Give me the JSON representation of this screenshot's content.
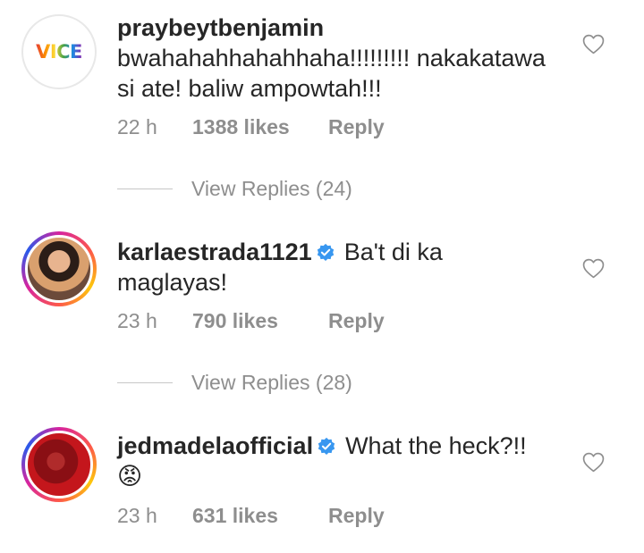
{
  "comments": [
    {
      "username": "praybeytbenjamin",
      "verified": false,
      "text_lines": [
        "bwahahahhahahhaha!!!!!!!!! nakakatawa",
        "si ate! baliw ampowtah!!!"
      ],
      "time": "22 h",
      "likes": "1388 likes",
      "reply_label": "Reply",
      "avatar_text": "VICE",
      "view_replies": "View Replies (24)"
    },
    {
      "username": "karlaestrada1121",
      "verified": true,
      "text_lines": [
        "Ba't di ka",
        "maglayas!"
      ],
      "time": "23 h",
      "likes": "790 likes",
      "reply_label": "Reply",
      "view_replies": "View Replies (28)"
    },
    {
      "username": "jedmadelaofficial",
      "verified": true,
      "text_lines": [
        "What the heck?!!",
        "😡"
      ],
      "time": "23 h",
      "likes": "631 likes",
      "reply_label": "Reply"
    }
  ],
  "colors": {
    "text": "#262626",
    "secondary": "#8e8e8e",
    "verified_blue": "#3897f0",
    "divider": "#c7c7c7"
  },
  "icons": [
    "heart-outline-icon",
    "verified-badge-icon"
  ]
}
